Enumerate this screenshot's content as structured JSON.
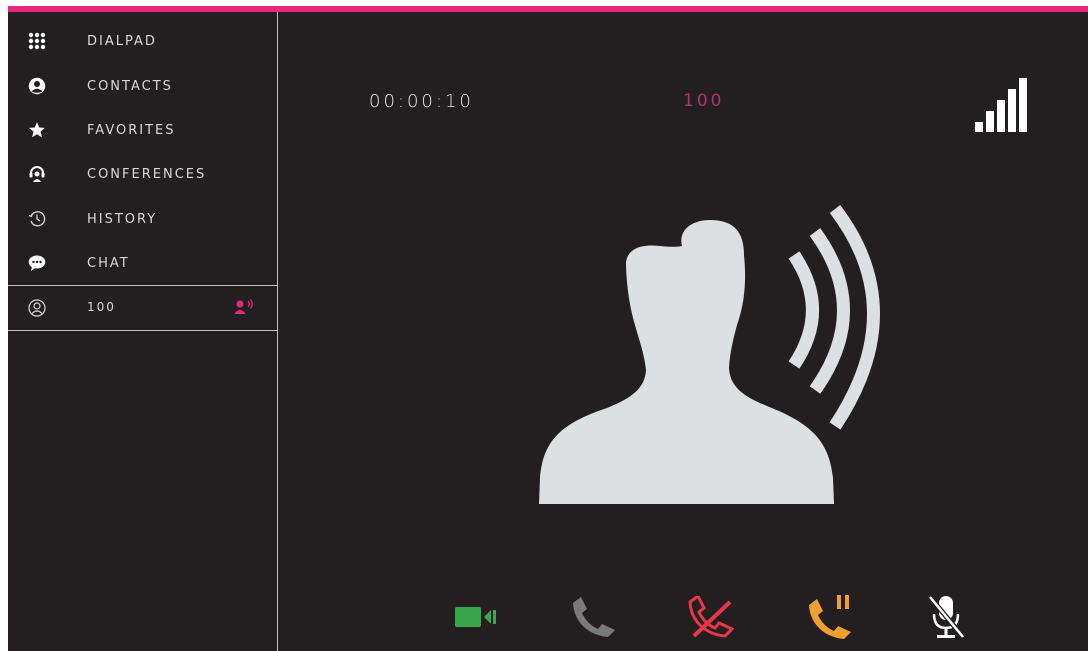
{
  "sidebar": {
    "items": [
      {
        "label": "DIALPAD",
        "icon": "dialpad-icon"
      },
      {
        "label": "CONTACTS",
        "icon": "contacts-icon"
      },
      {
        "label": "FAVORITES",
        "icon": "star-icon"
      },
      {
        "label": "CONFERENCES",
        "icon": "conference-icon"
      },
      {
        "label": "HISTORY",
        "icon": "history-icon"
      },
      {
        "label": "CHAT",
        "icon": "chat-icon"
      }
    ],
    "active_call": {
      "label": "100",
      "icon": "user-outline-icon",
      "status_icon": "speaking-user-icon"
    }
  },
  "call": {
    "timer": "00:00:10",
    "number": "100",
    "signal_icon": "signal-strength-icon"
  },
  "controls": [
    {
      "name": "video-button",
      "icon": "video-camera-icon",
      "color": "#3aa64c"
    },
    {
      "name": "transfer-button",
      "icon": "phone-icon",
      "color": "#7a7a7a"
    },
    {
      "name": "hangup-button",
      "icon": "hangup-icon",
      "color": "#e8364a"
    },
    {
      "name": "hold-button",
      "icon": "phone-hold-icon",
      "color": "#f0a030"
    },
    {
      "name": "mute-button",
      "icon": "mic-muted-icon",
      "color": "#ffffff"
    }
  ],
  "colors": {
    "accent": "#e5287c",
    "background": "#231f20",
    "number": "#b0326e"
  }
}
